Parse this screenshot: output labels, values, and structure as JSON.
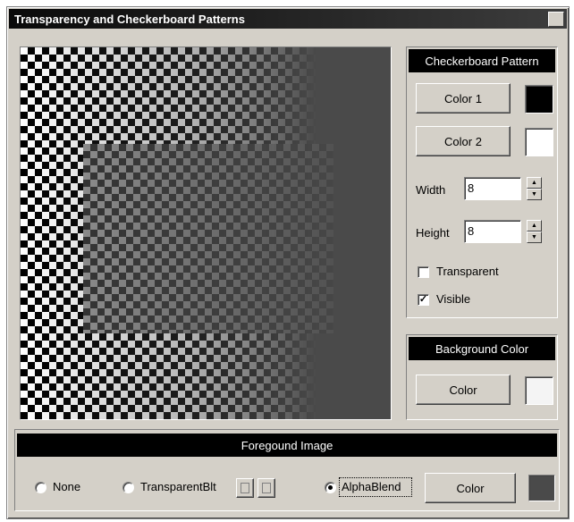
{
  "window": {
    "title": "Transparency and Checkerboard Patterns",
    "close_glyph": "×"
  },
  "checkerboard": {
    "header": "Checkerboard Pattern",
    "color1_label": "Color 1",
    "color1_value": "#000000",
    "color2_label": "Color 2",
    "color2_value": "#ffffff",
    "width_label": "Width",
    "width_value": "8",
    "height_label": "Height",
    "height_value": "8",
    "transparent_label": "Transparent",
    "transparent_checked": false,
    "visible_label": "Visible",
    "visible_checked": true
  },
  "background": {
    "header": "Background Color",
    "color_label": "Color",
    "color_value": "#f4f4f4"
  },
  "foreground": {
    "header": "Foregound Image",
    "options": [
      {
        "label": "None",
        "checked": false
      },
      {
        "label": "TransparentBlt",
        "checked": false
      },
      {
        "label": "AlphaBlend",
        "checked": true
      }
    ],
    "color_label": "Color",
    "color_value": "#4a4a4a"
  },
  "icons": {
    "spin_up": "▲",
    "spin_down": "▼",
    "check": "✓"
  }
}
